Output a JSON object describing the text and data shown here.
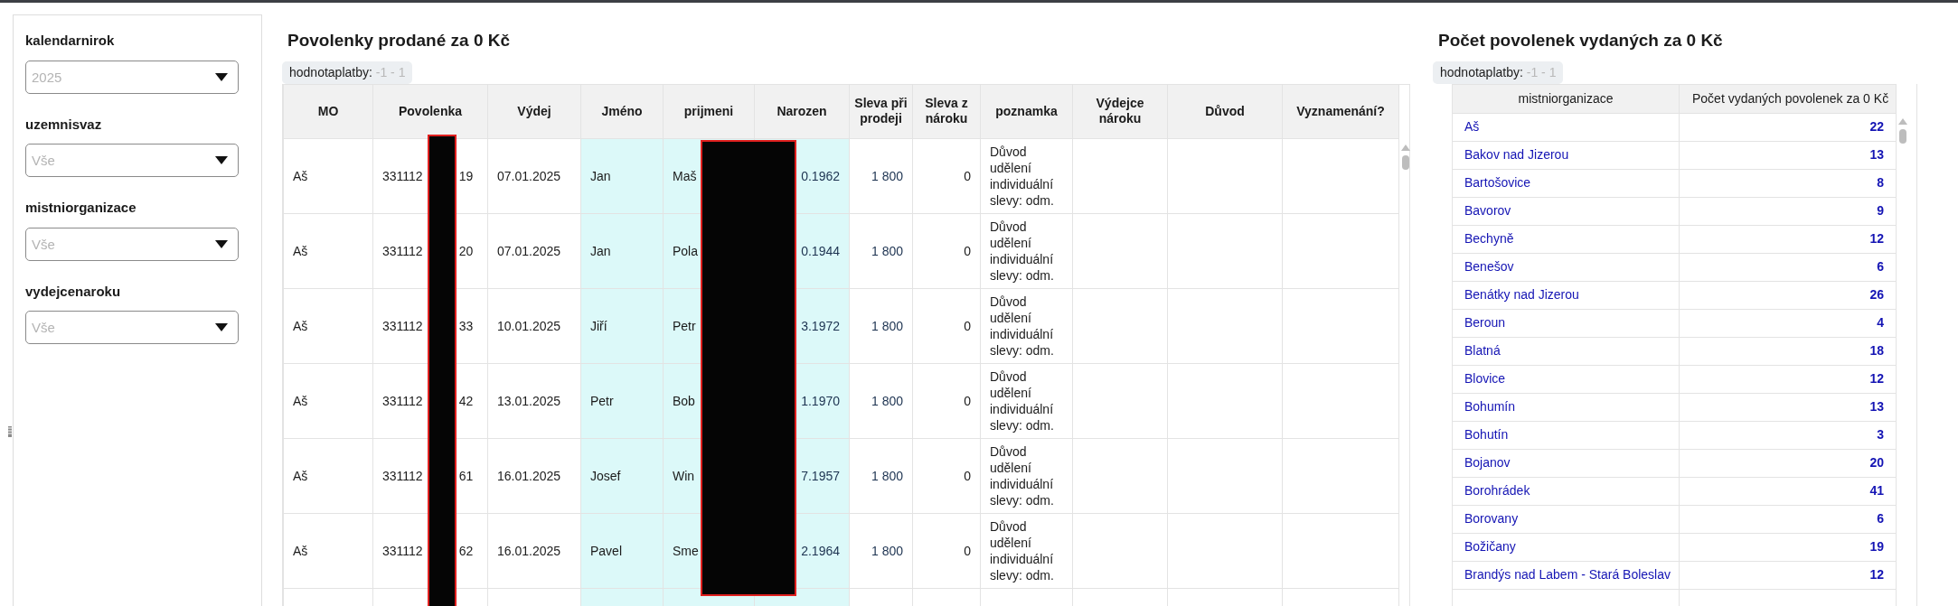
{
  "sidebar": {
    "filters": [
      {
        "label": "kalendarnirok",
        "placeholder": "2025"
      },
      {
        "label": "uzemnisvaz",
        "placeholder": "Vše"
      },
      {
        "label": "mistniorganizace",
        "placeholder": "Vše"
      },
      {
        "label": "vydejcenaroku",
        "placeholder": "Vše"
      }
    ]
  },
  "permits_panel": {
    "title": "Povolenky prodané za 0 Kč",
    "filter_chip": {
      "label": "hodnotaplatby:",
      "value": "-1 - 1"
    },
    "table": {
      "columns": [
        "MO",
        "Povolenka",
        "Výdej",
        "Jméno",
        "prijmeni",
        "Narozen",
        "Sleva při prodeji",
        "Sleva z nároku",
        "poznamka",
        "Výdejce nároku",
        "Důvod",
        "Vyznamenání?"
      ],
      "rows": [
        {
          "mo": "Aš",
          "povolenka_start": "331112",
          "povolenka_end": "19",
          "vydej": "07.01.2025",
          "jmeno": "Jan",
          "prijmeni": "Maš",
          "narozen": "0.1962",
          "sleva_pri_prodeji": "1 800",
          "sleva_z_naroku": "0",
          "poznamka": "Důvod udělení individuální slevy: odm."
        },
        {
          "mo": "Aš",
          "povolenka_start": "331112",
          "povolenka_end": "20",
          "vydej": "07.01.2025",
          "jmeno": "Jan",
          "prijmeni": "Pola",
          "narozen": "0.1944",
          "sleva_pri_prodeji": "1 800",
          "sleva_z_naroku": "0",
          "poznamka": "Důvod udělení individuální slevy: odm."
        },
        {
          "mo": "Aš",
          "povolenka_start": "331112",
          "povolenka_end": "33",
          "vydej": "10.01.2025",
          "jmeno": "Jiří",
          "prijmeni": "Petr",
          "narozen": "3.1972",
          "sleva_pri_prodeji": "1 800",
          "sleva_z_naroku": "0",
          "poznamka": "Důvod udělení individuální slevy: odm."
        },
        {
          "mo": "Aš",
          "povolenka_start": "331112",
          "povolenka_end": "42",
          "vydej": "13.01.2025",
          "jmeno": "Petr",
          "prijmeni": "Bob",
          "narozen": "1.1970",
          "sleva_pri_prodeji": "1 800",
          "sleva_z_naroku": "0",
          "poznamka": "Důvod udělení individuální slevy: odm."
        },
        {
          "mo": "Aš",
          "povolenka_start": "331112",
          "povolenka_end": "61",
          "vydej": "16.01.2025",
          "jmeno": "Josef",
          "prijmeni": "Win",
          "narozen": "7.1957",
          "sleva_pri_prodeji": "1 800",
          "sleva_z_naroku": "0",
          "poznamka": "Důvod udělení individuální slevy: odm."
        },
        {
          "mo": "Aš",
          "povolenka_start": "331112",
          "povolenka_end": "62",
          "vydej": "16.01.2025",
          "jmeno": "Pavel",
          "prijmeni": "Sme",
          "narozen": "2.1964",
          "sleva_pri_prodeji": "1 800",
          "sleva_z_naroku": "0",
          "poznamka": "Důvod udělení individuální slevy: odm."
        }
      ]
    }
  },
  "count_panel": {
    "title": "Počet povolenek vydaných za 0 Kč",
    "filter_chip": {
      "label": "hodnotaplatby:",
      "value": "-1 - 1"
    },
    "table": {
      "columns": [
        "mistniorganizace",
        "Počet vydaných povolenek za 0 Kč"
      ],
      "rows": [
        {
          "organizace": "Aš",
          "pocet": "22"
        },
        {
          "organizace": "Bakov nad Jizerou",
          "pocet": "13"
        },
        {
          "organizace": "Bartošovice",
          "pocet": "8"
        },
        {
          "organizace": "Bavorov",
          "pocet": "9"
        },
        {
          "organizace": "Bechyně",
          "pocet": "12"
        },
        {
          "organizace": "Benešov",
          "pocet": "6"
        },
        {
          "organizace": "Benátky nad Jizerou",
          "pocet": "26"
        },
        {
          "organizace": "Beroun",
          "pocet": "4"
        },
        {
          "organizace": "Blatná",
          "pocet": "18"
        },
        {
          "organizace": "Blovice",
          "pocet": "12"
        },
        {
          "organizace": "Bohumín",
          "pocet": "13"
        },
        {
          "organizace": "Bohutín",
          "pocet": "3"
        },
        {
          "organizace": "Bojanov",
          "pocet": "20"
        },
        {
          "organizace": "Borohrádek",
          "pocet": "41"
        },
        {
          "organizace": "Borovany",
          "pocet": "6"
        },
        {
          "organizace": "Božičany",
          "pocet": "19"
        },
        {
          "organizace": "Brandýs nad Labem - Stará Boleslav",
          "pocet": "12"
        }
      ]
    }
  }
}
